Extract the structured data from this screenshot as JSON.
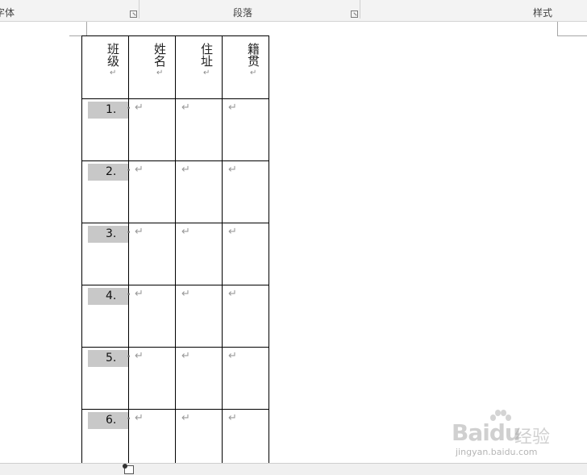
{
  "ribbon": {
    "groups": [
      {
        "label": "字体"
      },
      {
        "label": "段落"
      },
      {
        "label": "样式"
      }
    ]
  },
  "table": {
    "headers": [
      "班级",
      "姓名",
      "住址",
      "籍贯"
    ],
    "header_mark": "↵",
    "rows": [
      "1.",
      "2.",
      "3.",
      "4.",
      "5.",
      "6."
    ],
    "cell_mark": "↵",
    "list_dot": "•"
  },
  "watermark": {
    "brand": "Baidu",
    "cn": "经验",
    "url": "jingyan.baidu.com"
  },
  "colors": {
    "ribbon_bg": "#f3f3f3",
    "row_number_shade": "#c8c8c8",
    "table_border": "#000000"
  },
  "icons": {
    "status": "table-layout-icon",
    "launcher": "dialog-launcher-icon"
  }
}
